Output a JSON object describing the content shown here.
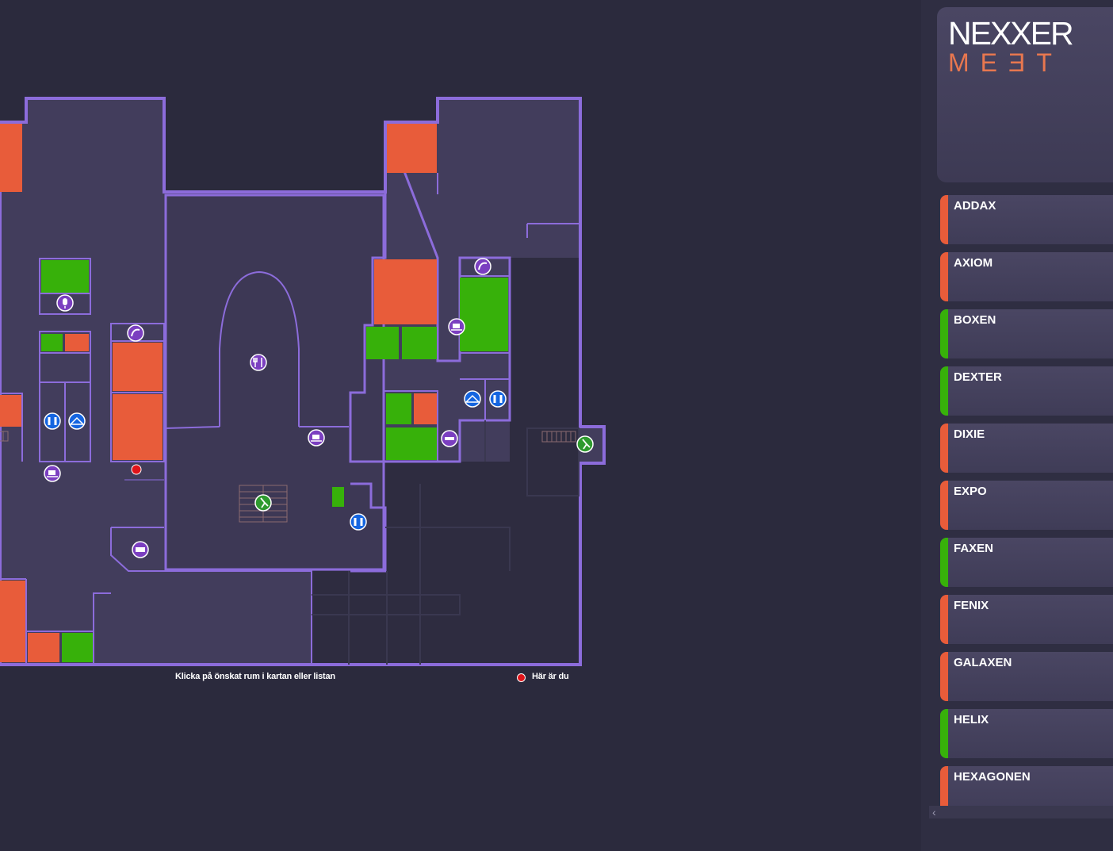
{
  "map": {
    "caption_hint": "Klicka på önskat rum i kartan eller listan",
    "legend_here": "Här är du",
    "colors": {
      "busy": "#e85c3a",
      "free": "#37b10a",
      "wall": "#8c6cdb",
      "floor": "#423d5c",
      "ground": "#2b2a3d",
      "here": "#e0141a"
    },
    "icons": [
      "microphone-icon",
      "phone-icon",
      "toilet-icon",
      "cloakroom-icon",
      "coffee-icon",
      "restaurant-icon",
      "emergency-exit-icon",
      "printer-icon",
      "bed-icon",
      "you-are-here-dot"
    ]
  },
  "sidebar": {
    "logo_top": "NEXXER",
    "logo_bottom": "MEƎT",
    "rooms": [
      {
        "name": "ADDAX",
        "status": "busy"
      },
      {
        "name": "AXIOM",
        "status": "busy"
      },
      {
        "name": "BOXEN",
        "status": "free"
      },
      {
        "name": "DEXTER",
        "status": "free"
      },
      {
        "name": "DIXIE",
        "status": "busy"
      },
      {
        "name": "EXPO",
        "status": "busy"
      },
      {
        "name": "FAXEN",
        "status": "free"
      },
      {
        "name": "FENIX",
        "status": "busy"
      },
      {
        "name": "GALAXEN",
        "status": "busy"
      },
      {
        "name": "HELIX",
        "status": "free"
      },
      {
        "name": "HEXAGONEN",
        "status": "busy"
      }
    ]
  }
}
